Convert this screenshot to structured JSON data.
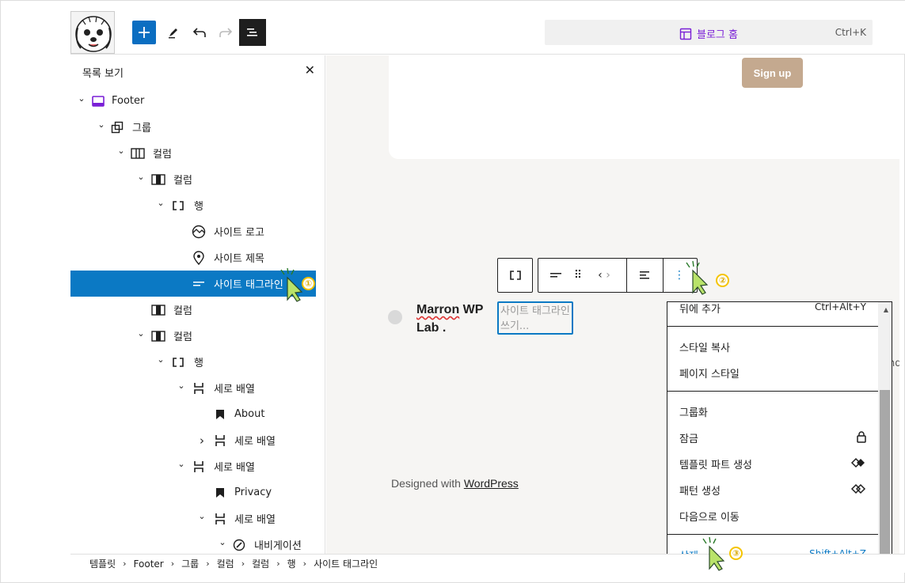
{
  "topbar": {
    "add_icon": "plus-icon",
    "command_title": "블로그 홈",
    "command_shortcut": "Ctrl+K"
  },
  "listview": {
    "title": "목록 보기",
    "rows": [
      {
        "label": "Footer",
        "icon": "template-part-icon",
        "expanded": true
      },
      {
        "label": "그룹",
        "icon": "group-icon",
        "expanded": true
      },
      {
        "label": "컬럼",
        "icon": "columns-icon",
        "expanded": true
      },
      {
        "label": "컬럼",
        "icon": "column-icon",
        "expanded": true
      },
      {
        "label": "행",
        "icon": "row-icon",
        "expanded": true
      },
      {
        "label": "사이트 로고",
        "icon": "site-logo-icon"
      },
      {
        "label": "사이트 제목",
        "icon": "map-marker-icon"
      },
      {
        "label": "사이트 태그라인",
        "icon": "tagline-icon",
        "selected": true
      },
      {
        "label": "컬럼",
        "icon": "column-icon"
      },
      {
        "label": "컬럼",
        "icon": "column-icon",
        "expanded": true
      },
      {
        "label": "행",
        "icon": "row-icon",
        "expanded": true
      },
      {
        "label": "세로 배열",
        "icon": "stack-icon",
        "expanded": true
      },
      {
        "label": "About",
        "icon": "bookmark-icon"
      },
      {
        "label": "세로 배열",
        "icon": "stack-icon",
        "expanded": false
      },
      {
        "label": "세로 배열",
        "icon": "stack-icon",
        "expanded": true
      },
      {
        "label": "Privacy",
        "icon": "bookmark-icon"
      },
      {
        "label": "세로 배열",
        "icon": "stack-icon",
        "expanded": true
      },
      {
        "label": "내비게이션",
        "icon": "navigation-icon",
        "expanded": true
      }
    ]
  },
  "breadcrumb": [
    "템플릿",
    "Footer",
    "그룹",
    "컬럼",
    "컬럼",
    "행",
    "사이트 태그라인"
  ],
  "canvas": {
    "signup_label": "Sign up",
    "site_title": "Marron WP Lab .",
    "site_title_word1": "Marron",
    "site_title_rest": " WP Lab .",
    "tagline_placeholder": "사이트 태그라인 쓰기...",
    "designed_prefix": "Designed with ",
    "designed_link": "WordPress",
    "edge_text": "nd"
  },
  "menu": {
    "items": [
      {
        "label": "뒤에 추가",
        "shortcut": "Ctrl+Alt+Y"
      },
      {
        "label": "스타일 복사"
      },
      {
        "label": "페이지 스타일"
      },
      {
        "label": "그룹화"
      },
      {
        "label": "잠금",
        "icon": "lock-icon"
      },
      {
        "label": "템플릿 파트 생성",
        "icon": "template-part-solid-icon"
      },
      {
        "label": "패턴 생성",
        "icon": "pattern-icon"
      },
      {
        "label": "다음으로 이동"
      },
      {
        "label": "삭제",
        "shortcut": "Shift+Alt+Z"
      }
    ]
  },
  "annotations": [
    "①",
    "②",
    "③"
  ],
  "colors": {
    "accent": "#0b79c4",
    "command_purple": "#7a1fd6",
    "signup_bg": "#c4a98f",
    "annotation_yellow": "#f5c400",
    "cursor_green": "#b9e36a"
  }
}
